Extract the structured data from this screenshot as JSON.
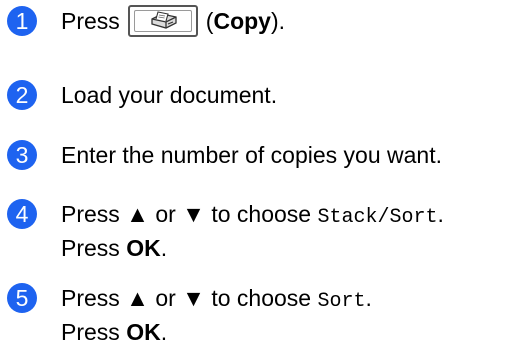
{
  "steps": [
    {
      "number": "1",
      "text_before": "Press",
      "icon": "copier-icon",
      "text_open": "(",
      "bold": "Copy",
      "text_close": ")."
    },
    {
      "number": "2",
      "text": "Load your document."
    },
    {
      "number": "3",
      "text": "Enter the number of copies you want."
    },
    {
      "number": "4",
      "line1_before": "Press ▲ or ▼ to choose",
      "line1_code": "Stack/Sort",
      "line1_after": ".",
      "line2_before": "Press",
      "line2_bold": "OK",
      "line2_after": "."
    },
    {
      "number": "5",
      "line1_before": "Press ▲ or ▼ to choose",
      "line1_code": "Sort",
      "line1_after": ".",
      "line2_before": "Press",
      "line2_bold": "OK",
      "line2_after": "."
    }
  ],
  "colors": {
    "step_badge": "#1e63f0"
  }
}
